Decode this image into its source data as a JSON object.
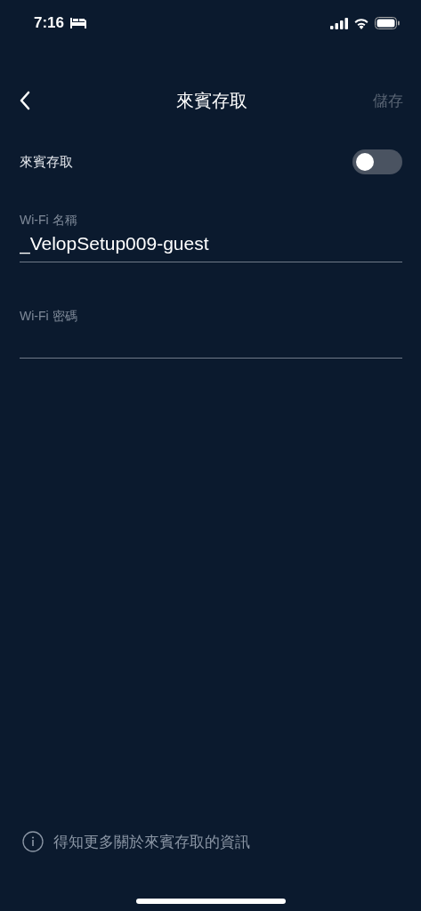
{
  "status_bar": {
    "time": "7:16"
  },
  "nav": {
    "title": "來賓存取",
    "save_button": {
      "label": "儲存",
      "disabled": true
    }
  },
  "guest_access": {
    "label": "來賓存取",
    "on": false
  },
  "fields": [
    {
      "label": "Wi-Fi 名稱",
      "value": "_VelopSetup009-guest"
    },
    {
      "label": "Wi-Fi 密碼"
    }
  ],
  "info_link": "得知更多關於來賓存取的資訊"
}
